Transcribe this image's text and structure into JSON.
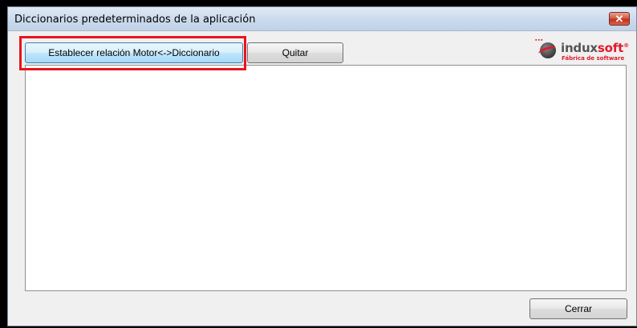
{
  "window": {
    "title": "Diccionarios predeterminados de la aplicación",
    "close_symbol": "✕"
  },
  "toolbar": {
    "establecer_label": "Establecer relación Motor<->Diccionario",
    "quitar_label": "Quitar"
  },
  "logo": {
    "name_prefix": "indux",
    "name_suffix": "soft",
    "trademark": "®",
    "tagline": "Fábrica de software"
  },
  "list": {
    "items": []
  },
  "footer": {
    "cerrar_label": "Cerrar"
  },
  "colors": {
    "highlight": "#e8141e",
    "brand_red": "#e01a2b",
    "accent_button": "#3c7fb1"
  }
}
